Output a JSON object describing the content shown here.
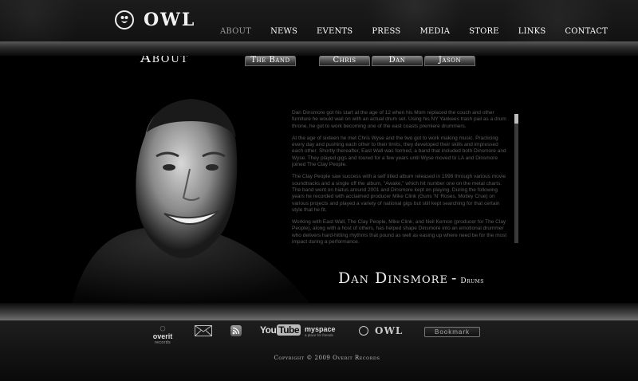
{
  "header": {
    "logo_text": "OWL",
    "nav": [
      {
        "label": "ABOUT",
        "active": true
      },
      {
        "label": "NEWS",
        "active": false
      },
      {
        "label": "EVENTS",
        "active": false
      },
      {
        "label": "PRESS",
        "active": false
      },
      {
        "label": "MEDIA",
        "active": false
      },
      {
        "label": "STORE",
        "active": false
      },
      {
        "label": "LINKS",
        "active": false
      },
      {
        "label": "CONTACT",
        "active": false
      }
    ]
  },
  "main": {
    "title": "About",
    "tabs": {
      "band": "The Band",
      "chris": "Chris",
      "dan": "Dan",
      "jason": "Jason"
    },
    "bio": [
      "Dan Dinsmore got his start at the age of 12 when his Mom replaced the couch and other furniture he would wail on with an actual drum set.  Using his NY Yankees trash pail as a drum throne, he got to work becoming one of the east coasts premiere drummers.",
      "At the age of sixteen he met Chris Wyse and the two got to work making music.  Practicing every day and pushing each other to their limits, they developed their skills and impressed each other.  Shortly thereafter, East Wall was formed, a band that included both Dinsmore and Wyse.  They played gigs and toured for a few years until Wyse moved to LA and Dinsmore joined The Clay People.",
      "The Clay People saw success with a self titled album released in 1998 through various movie soundtracks and a single off the album,  \"Awake,\" which hit number one on the metal charts.  The band went on hiatus around 2001 and Dinsmore kept on playing.  During the following years he recorded with acclaimed producer Mike Clink (Guns 'N' Roses, Motley Crue) on various projects and played a variety of national gigs but still kept searching for that certain style that he fit.",
      "Working with East Wall, The Clay People, Mike Clink, and Neil Kernon (producer for The Clay People), along with a host of others, has helped shape Dinsmore into an emotional drummer who delivers hard-hitting rhythms that pound as well as easing up where need be for the most impact during a performance."
    ],
    "member": {
      "name": "Dan Dinsmore",
      "separator": "-",
      "role": "Drums"
    }
  },
  "footer": {
    "overit_name": "overit",
    "overit_sub": "records",
    "youtube_a": "You",
    "youtube_b": "Tube",
    "myspace_name": "myspace",
    "myspace_tag": "a place for friends",
    "owl_text": "OWL",
    "bookmark": "Bookmark",
    "copyright": "Copyright © 2009 Overit Records"
  },
  "colors": {
    "background": "#000000",
    "bio_text": "#5c5c5c",
    "nav_active": "#9a9a9a"
  }
}
